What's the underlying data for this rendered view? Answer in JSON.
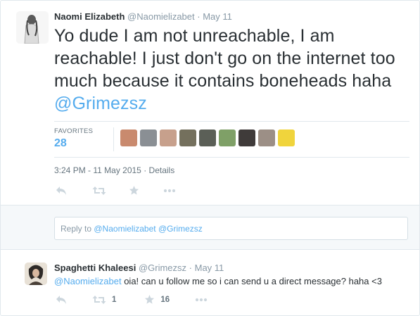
{
  "tweet": {
    "author_name": "Naomi Elizabeth",
    "author_handle": "@Naomielizabet",
    "separator": "·",
    "date": "May 11",
    "text_main": "Yo dude I am not unreachable, I am reachable! I just don't go on the internet too much because it contains boneheads haha",
    "text_mention": "@Grimezsz",
    "favorites_label": "FAVORITES",
    "favorites_count": "28",
    "timestamp": "3:24 PM - 11 May 2015",
    "details_separator": "·",
    "details_label": "Details"
  },
  "favoriter_avatar_colors": [
    "#c98a6e",
    "#8a8f94",
    "#c7a08c",
    "#74705d",
    "#5b5f57",
    "#7fa067",
    "#3f3b3a",
    "#9c8f86",
    "#f0d43c"
  ],
  "reply_box": {
    "prefix": "Reply to",
    "mention1": "@Naomielizabet",
    "mention2": "@Grimezsz"
  },
  "reply_tweet": {
    "author_name": "Spaghetti Khaleesi",
    "author_handle": "@Grimezsz",
    "separator": "·",
    "date": "May 11",
    "text_mention": "@Naomielizabet",
    "text_rest": "oia! can u follow me so i can send u a direct message? haha <3",
    "retweet_count": "1",
    "favorite_count": "16"
  },
  "icons": [
    "reply-icon",
    "retweet-icon",
    "favorite-icon",
    "more-icon"
  ],
  "colors": {
    "accent": "#55acee",
    "text": "#292f33",
    "muted": "#8899a6",
    "icon": "#ccd6dd",
    "border": "#e1e8ed",
    "panel": "#f5f8fa"
  }
}
